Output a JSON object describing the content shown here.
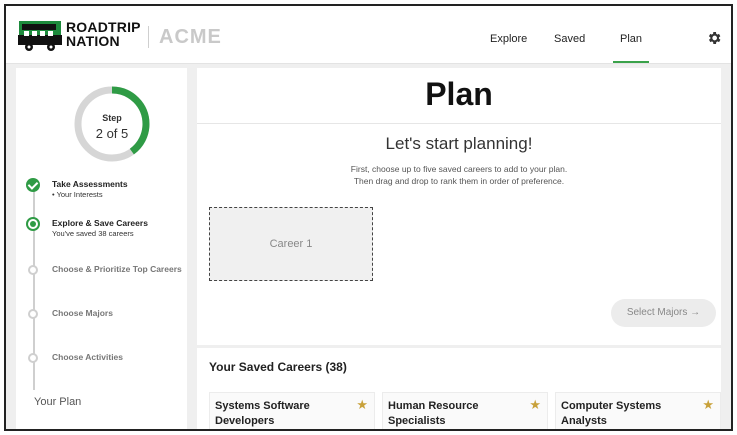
{
  "header": {
    "logo_line1": "ROADTRIP",
    "logo_line2": "NATION",
    "partner": "ACME",
    "nav": [
      "Explore",
      "Saved",
      "Plan"
    ],
    "active_nav": "Plan",
    "accent_color": "#3aa24a"
  },
  "sidebar": {
    "step_label": "Step",
    "step_count": "2 of 5",
    "progress_fraction": 0.4,
    "steps": [
      {
        "title": "Take Assessments",
        "sub": "• Your Interests",
        "state": "done"
      },
      {
        "title": "Explore & Save Careers",
        "sub": "You've saved 38 careers",
        "state": "current"
      },
      {
        "title": "Choose & Prioritize Top Careers",
        "sub": "",
        "state": "todo"
      },
      {
        "title": "Choose Majors",
        "sub": "",
        "state": "todo"
      },
      {
        "title": "Choose Activities",
        "sub": "",
        "state": "todo"
      }
    ],
    "your_plan": "Your Plan"
  },
  "plan": {
    "title": "Plan",
    "subtitle": "Let's start planning!",
    "instructions_line1": "First, choose up to five saved careers to add to your plan.",
    "instructions_line2": "Then drag and drop to rank them in order of preference.",
    "slot_label": "Career 1",
    "select_majors": "Select Majors →"
  },
  "saved": {
    "title": "Your Saved Careers (38)",
    "careers": [
      {
        "name": "Systems Software Developers"
      },
      {
        "name": "Human Resource Specialists"
      },
      {
        "name": "Computer Systems Analysts"
      }
    ]
  },
  "icons": {
    "gear": "gear-icon",
    "star": "star-icon",
    "bus": "bus-logo-icon"
  }
}
